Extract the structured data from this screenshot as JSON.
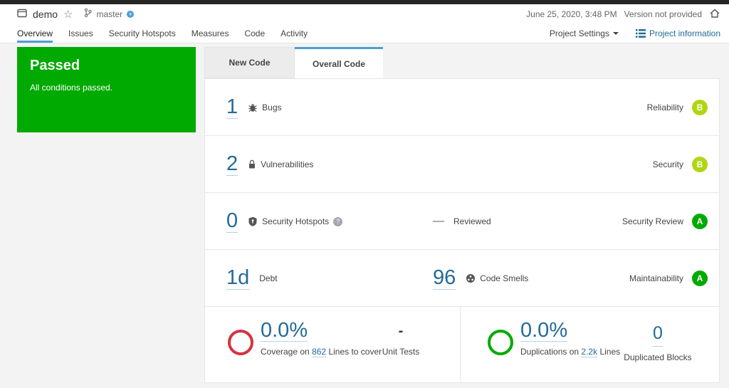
{
  "topbar": {
    "project": "demo",
    "branch": "master",
    "date": "June 25, 2020, 3:48 PM",
    "version": "Version not provided"
  },
  "icons": {
    "star": "☆",
    "branch_status": "+",
    "help": "?"
  },
  "nav": {
    "items": [
      {
        "label": "Overview",
        "active": true
      },
      {
        "label": "Issues",
        "active": false
      },
      {
        "label": "Security Hotspots",
        "active": false
      },
      {
        "label": "Measures",
        "active": false
      },
      {
        "label": "Code",
        "active": false
      },
      {
        "label": "Activity",
        "active": false
      }
    ],
    "project_settings": "Project Settings",
    "project_information": "Project information"
  },
  "gate": {
    "status": "Passed",
    "description": "All conditions passed."
  },
  "tabs": [
    {
      "label": "New Code",
      "active": false
    },
    {
      "label": "Overall Code",
      "active": true
    }
  ],
  "m": {
    "bugs": {
      "value": "1",
      "label": "Bugs",
      "rating_label": "Reliability",
      "grade": "B"
    },
    "vuln": {
      "value": "2",
      "label": "Vulnerabilities",
      "rating_label": "Security",
      "grade": "B"
    },
    "hotspots": {
      "value": "0",
      "label": "Security Hotspots",
      "reviewed_value": "—",
      "reviewed_label": "Reviewed",
      "rating_label": "Security Review",
      "grade": "A"
    },
    "maint": {
      "debt_value": "1d",
      "debt_label": "Debt",
      "smells_value": "96",
      "smells_label": "Code Smells",
      "rating_label": "Maintainability",
      "grade": "A"
    },
    "coverage": {
      "value": "0.0%",
      "prefix": "Coverage on",
      "link": "862",
      "suffix": "Lines to cover",
      "tests_value": "-",
      "tests_label": "Unit Tests"
    },
    "dup": {
      "value": "0.0%",
      "prefix": "Duplications on",
      "link": "2.2k",
      "suffix": "Lines",
      "blocks_value": "0",
      "blocks_label": "Duplicated Blocks"
    }
  },
  "colors": {
    "passed_green": "#00aa00",
    "rating_a": "#00aa00",
    "rating_b": "#b0d513",
    "link_blue": "#236a97",
    "active_tab_blue": "#4b9fd5",
    "coverage_ring_red": "#d4333f",
    "duplication_ring_green": "#00aa00",
    "topbar_dark": "#262626",
    "page_bg": "#f3f3f3"
  }
}
